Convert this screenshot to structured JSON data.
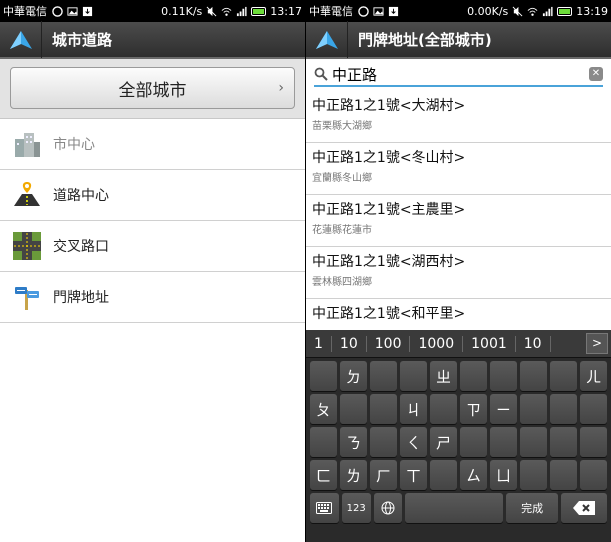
{
  "left": {
    "status": {
      "carrier": "中華電信",
      "speed": "0.11K/s",
      "time": "13:17"
    },
    "title": "城市道路",
    "all_city_button": "全部城市",
    "items": [
      {
        "label": "市中心",
        "icon": "city-center-icon",
        "enabled": false
      },
      {
        "label": "道路中心",
        "icon": "road-center-icon",
        "enabled": true
      },
      {
        "label": "交叉路口",
        "icon": "intersection-icon",
        "enabled": true
      },
      {
        "label": "門牌地址",
        "icon": "address-sign-icon",
        "enabled": true
      }
    ]
  },
  "right": {
    "status": {
      "carrier": "中華電信",
      "speed": "0.00K/s",
      "time": "13:19"
    },
    "title": "門牌地址(全部城市)",
    "search": {
      "value": "中正路"
    },
    "results": [
      {
        "address": "中正路1之1號<大湖村>",
        "area": "苗栗縣大湖鄉"
      },
      {
        "address": "中正路1之1號<冬山村>",
        "area": "宜蘭縣冬山鄉"
      },
      {
        "address": "中正路1之1號<主農里>",
        "area": "花蓮縣花蓮市"
      },
      {
        "address": "中正路1之1號<湖西村>",
        "area": "雲林縣四湖鄉"
      },
      {
        "address": "中正路1之1號<和平里>",
        "area": ""
      }
    ],
    "keyboard": {
      "candidates": [
        "1",
        "10",
        "100",
        "1000",
        "1001",
        "10"
      ],
      "rows": [
        [
          "",
          "ㄉ",
          "",
          "",
          "ㄓ",
          "",
          "",
          "",
          "",
          "ㄦ"
        ],
        [
          "ㄆ",
          "",
          "",
          "ㄐ",
          "",
          "ㄗ",
          "ㄧ",
          "",
          "",
          ""
        ],
        [
          "",
          "ㄋ",
          "",
          "ㄑ",
          "ㄕ",
          "",
          "",
          "",
          "",
          ""
        ],
        [
          "ㄈ",
          "ㄌ",
          "ㄏ",
          "ㄒ",
          "",
          "ㄙ",
          "ㄩ",
          "",
          "",
          ""
        ]
      ],
      "bottom": {
        "num_label": "123",
        "done_label": "完成"
      }
    }
  }
}
